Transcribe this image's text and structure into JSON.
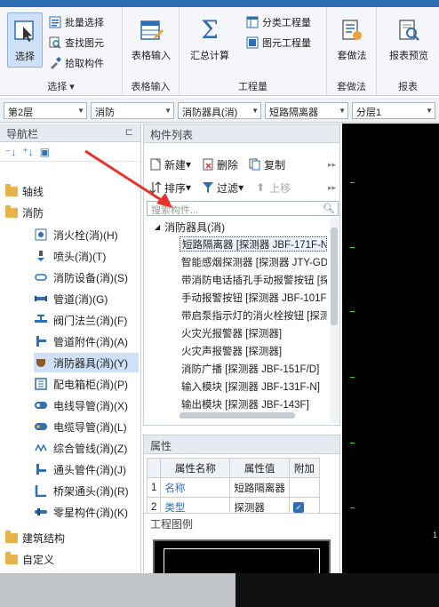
{
  "ribbon": {
    "groups": {
      "select": {
        "label": "选择",
        "select_btn": "选择",
        "batch_select": "批量选择",
        "find_element": "查找图元",
        "pick_component": "拾取构件"
      },
      "table_input": {
        "label": "表格输入",
        "btn": "表格输入"
      },
      "quantity": {
        "label": "工程量",
        "summary_calc": "汇总计算",
        "category_quantity": "分类工程量",
        "element_quantity": "图元工程量"
      },
      "method": {
        "label": "套做法",
        "btn": "套做法"
      },
      "report": {
        "label": "报表",
        "btn": "报表预览"
      }
    }
  },
  "selectors": {
    "floor": "第2层",
    "discipline": "消防",
    "type": "消防器具(消)",
    "component": "短路隔离器",
    "layer": "分层1"
  },
  "nav": {
    "title": "导航栏",
    "categories": [
      "轴线",
      "消防",
      "建筑结构",
      "自定义"
    ],
    "items": [
      "消火栓(消)(H)",
      "喷头(消)(T)",
      "消防设备(消)(S)",
      "管道(消)(G)",
      "阀门法兰(消)(F)",
      "管道附件(消)(A)",
      "消防器具(消)(Y)",
      "配电箱柜(消)(P)",
      "电线导管(消)(X)",
      "电缆导管(消)(L)",
      "综合管线(消)(Z)",
      "通头管件(消)(J)",
      "桥架通头(消)(R)",
      "零星构件(消)(K)"
    ]
  },
  "component_list": {
    "title": "构件列表",
    "toolbar": {
      "new": "新建",
      "delete": "删除",
      "copy": "复制",
      "sort": "排序",
      "filter": "过滤",
      "move_up": "上移"
    },
    "search_placeholder": "搜索构件...",
    "group": "消防器具(消)",
    "items": [
      "短路隔离器 [探测器 JBF-171F-N",
      "智能感烟探测器 [探测器 JTY-GD",
      "带消防电话插孔手动报警按钮 [探",
      "手动报警按钮 [探测器 JBF-101F",
      "带启泵指示灯的消火栓按钮 [探测",
      "火灾光报警器 [探测器]",
      "火灾声报警器 [探测器]",
      "消防广播 [探测器 JBF-151F/D]",
      "输入模块 [探测器 JBF-131F-N]",
      "输出模块 [探测器 JBF-143F]"
    ]
  },
  "properties": {
    "title": "属性",
    "headers": [
      "属性名称",
      "属性值",
      "附加"
    ],
    "rows": [
      {
        "index": "1",
        "name": "名称",
        "value": "短路隔离器"
      },
      {
        "index": "2",
        "name": "类型",
        "value": "探测器"
      }
    ]
  },
  "legend": {
    "title": "工程图例"
  },
  "canvas": {
    "readout": "1"
  },
  "colors": {
    "accent": "#2f6db5",
    "selected": "#cfe1f6",
    "arrow": "#e8322c"
  }
}
